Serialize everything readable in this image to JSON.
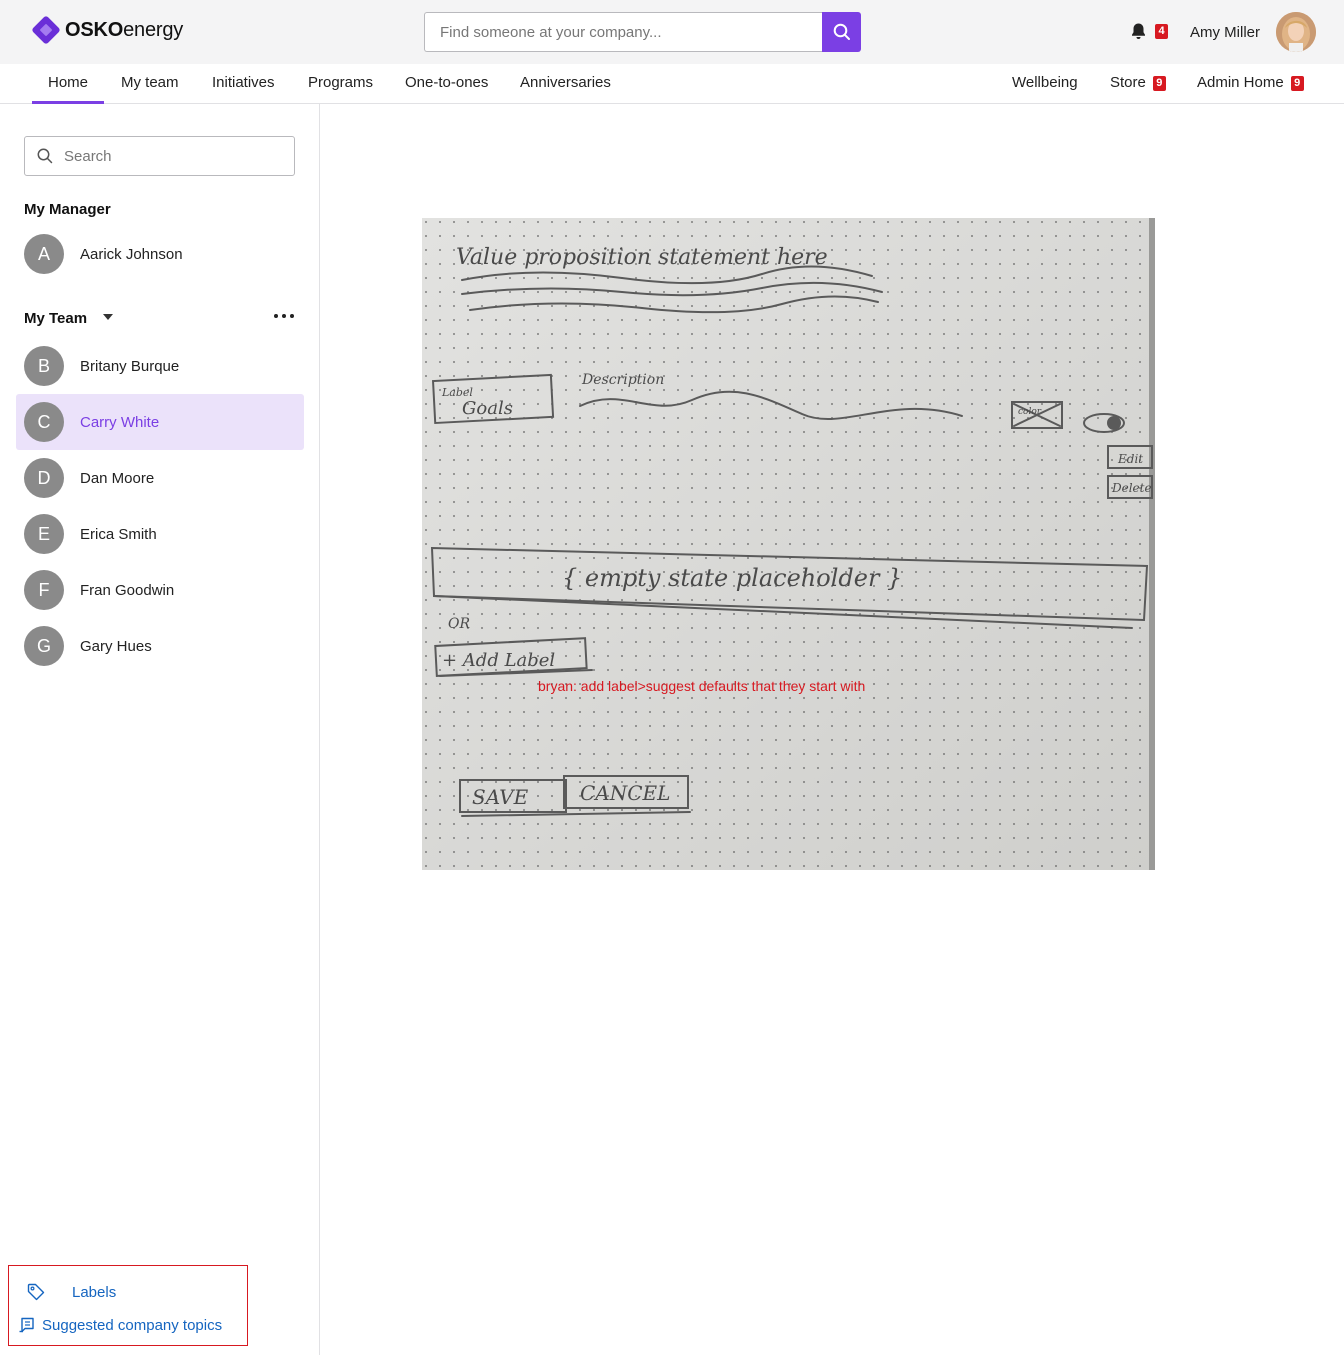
{
  "header": {
    "logo_bold": "OSKO",
    "logo_light": "energy",
    "search_placeholder": "Find someone at your company...",
    "notification_count": "4",
    "user_name": "Amy Miller"
  },
  "nav": {
    "left": [
      "Home",
      "My team",
      "Initiatives",
      "Programs",
      "One-to-ones",
      "Anniversaries"
    ],
    "right": [
      {
        "label": "Wellbeing",
        "badge": ""
      },
      {
        "label": "Store",
        "badge": "9"
      },
      {
        "label": "Admin Home",
        "badge": "9"
      }
    ],
    "active": "Home"
  },
  "sidebar": {
    "search_placeholder": "Search",
    "manager_title": "My Manager",
    "manager": {
      "initial": "A",
      "name": "Aarick Johnson"
    },
    "team_title": "My Team",
    "team": [
      {
        "initial": "B",
        "name": "Britany Burque"
      },
      {
        "initial": "C",
        "name": "Carry White"
      },
      {
        "initial": "D",
        "name": "Dan Moore"
      },
      {
        "initial": "E",
        "name": "Erica Smith"
      },
      {
        "initial": "F",
        "name": "Fran Goodwin"
      },
      {
        "initial": "G",
        "name": "Gary Hues"
      }
    ],
    "selected": "Carry White",
    "links": {
      "labels": "Labels",
      "topics": "Suggested company topics"
    }
  },
  "sketch": {
    "heading": "Value proposition statement here",
    "label_tag": "Label",
    "label_value": "Goals",
    "description": "Description",
    "color": "color",
    "edit": "Edit",
    "delete": "Delete",
    "empty_state": "{ empty state placeholder }",
    "or": "OR",
    "add_label": "+ Add Label",
    "save": "SAVE",
    "cancel": "CANCEL",
    "note": "bryan: add label>suggest defaults that they start with"
  },
  "colors": {
    "accent": "#7b3fe4",
    "badge": "#d71921",
    "link": "#1565c0",
    "selected_bg": "#ebe2fa"
  }
}
